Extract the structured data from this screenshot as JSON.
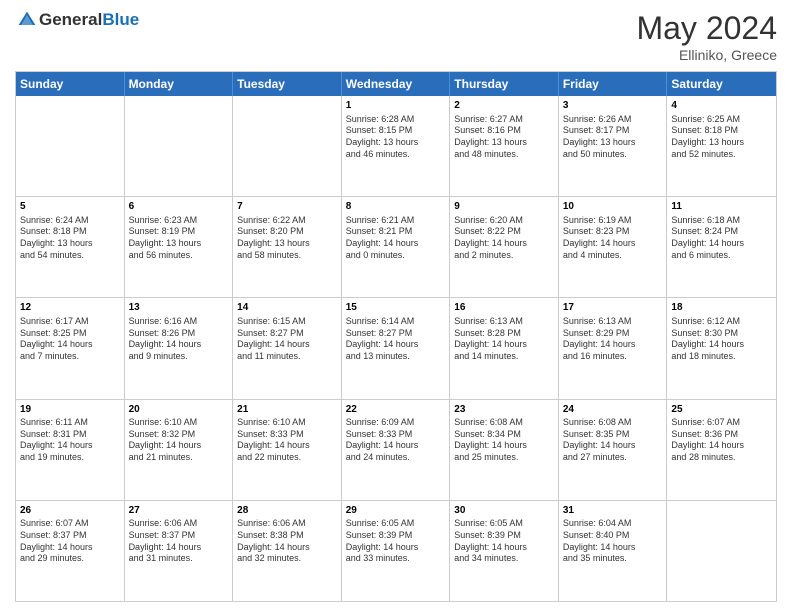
{
  "header": {
    "logo": {
      "general": "General",
      "blue": "Blue"
    },
    "title": "May 2024",
    "location": "Elliniko, Greece"
  },
  "weekdays": [
    "Sunday",
    "Monday",
    "Tuesday",
    "Wednesday",
    "Thursday",
    "Friday",
    "Saturday"
  ],
  "rows": [
    [
      {
        "date": "",
        "info": ""
      },
      {
        "date": "",
        "info": ""
      },
      {
        "date": "",
        "info": ""
      },
      {
        "date": "1",
        "info": "Sunrise: 6:28 AM\nSunset: 8:15 PM\nDaylight: 13 hours\nand 46 minutes."
      },
      {
        "date": "2",
        "info": "Sunrise: 6:27 AM\nSunset: 8:16 PM\nDaylight: 13 hours\nand 48 minutes."
      },
      {
        "date": "3",
        "info": "Sunrise: 6:26 AM\nSunset: 8:17 PM\nDaylight: 13 hours\nand 50 minutes."
      },
      {
        "date": "4",
        "info": "Sunrise: 6:25 AM\nSunset: 8:18 PM\nDaylight: 13 hours\nand 52 minutes."
      }
    ],
    [
      {
        "date": "5",
        "info": "Sunrise: 6:24 AM\nSunset: 8:18 PM\nDaylight: 13 hours\nand 54 minutes."
      },
      {
        "date": "6",
        "info": "Sunrise: 6:23 AM\nSunset: 8:19 PM\nDaylight: 13 hours\nand 56 minutes."
      },
      {
        "date": "7",
        "info": "Sunrise: 6:22 AM\nSunset: 8:20 PM\nDaylight: 13 hours\nand 58 minutes."
      },
      {
        "date": "8",
        "info": "Sunrise: 6:21 AM\nSunset: 8:21 PM\nDaylight: 14 hours\nand 0 minutes."
      },
      {
        "date": "9",
        "info": "Sunrise: 6:20 AM\nSunset: 8:22 PM\nDaylight: 14 hours\nand 2 minutes."
      },
      {
        "date": "10",
        "info": "Sunrise: 6:19 AM\nSunset: 8:23 PM\nDaylight: 14 hours\nand 4 minutes."
      },
      {
        "date": "11",
        "info": "Sunrise: 6:18 AM\nSunset: 8:24 PM\nDaylight: 14 hours\nand 6 minutes."
      }
    ],
    [
      {
        "date": "12",
        "info": "Sunrise: 6:17 AM\nSunset: 8:25 PM\nDaylight: 14 hours\nand 7 minutes."
      },
      {
        "date": "13",
        "info": "Sunrise: 6:16 AM\nSunset: 8:26 PM\nDaylight: 14 hours\nand 9 minutes."
      },
      {
        "date": "14",
        "info": "Sunrise: 6:15 AM\nSunset: 8:27 PM\nDaylight: 14 hours\nand 11 minutes."
      },
      {
        "date": "15",
        "info": "Sunrise: 6:14 AM\nSunset: 8:27 PM\nDaylight: 14 hours\nand 13 minutes."
      },
      {
        "date": "16",
        "info": "Sunrise: 6:13 AM\nSunset: 8:28 PM\nDaylight: 14 hours\nand 14 minutes."
      },
      {
        "date": "17",
        "info": "Sunrise: 6:13 AM\nSunset: 8:29 PM\nDaylight: 14 hours\nand 16 minutes."
      },
      {
        "date": "18",
        "info": "Sunrise: 6:12 AM\nSunset: 8:30 PM\nDaylight: 14 hours\nand 18 minutes."
      }
    ],
    [
      {
        "date": "19",
        "info": "Sunrise: 6:11 AM\nSunset: 8:31 PM\nDaylight: 14 hours\nand 19 minutes."
      },
      {
        "date": "20",
        "info": "Sunrise: 6:10 AM\nSunset: 8:32 PM\nDaylight: 14 hours\nand 21 minutes."
      },
      {
        "date": "21",
        "info": "Sunrise: 6:10 AM\nSunset: 8:33 PM\nDaylight: 14 hours\nand 22 minutes."
      },
      {
        "date": "22",
        "info": "Sunrise: 6:09 AM\nSunset: 8:33 PM\nDaylight: 14 hours\nand 24 minutes."
      },
      {
        "date": "23",
        "info": "Sunrise: 6:08 AM\nSunset: 8:34 PM\nDaylight: 14 hours\nand 25 minutes."
      },
      {
        "date": "24",
        "info": "Sunrise: 6:08 AM\nSunset: 8:35 PM\nDaylight: 14 hours\nand 27 minutes."
      },
      {
        "date": "25",
        "info": "Sunrise: 6:07 AM\nSunset: 8:36 PM\nDaylight: 14 hours\nand 28 minutes."
      }
    ],
    [
      {
        "date": "26",
        "info": "Sunrise: 6:07 AM\nSunset: 8:37 PM\nDaylight: 14 hours\nand 29 minutes."
      },
      {
        "date": "27",
        "info": "Sunrise: 6:06 AM\nSunset: 8:37 PM\nDaylight: 14 hours\nand 31 minutes."
      },
      {
        "date": "28",
        "info": "Sunrise: 6:06 AM\nSunset: 8:38 PM\nDaylight: 14 hours\nand 32 minutes."
      },
      {
        "date": "29",
        "info": "Sunrise: 6:05 AM\nSunset: 8:39 PM\nDaylight: 14 hours\nand 33 minutes."
      },
      {
        "date": "30",
        "info": "Sunrise: 6:05 AM\nSunset: 8:39 PM\nDaylight: 14 hours\nand 34 minutes."
      },
      {
        "date": "31",
        "info": "Sunrise: 6:04 AM\nSunset: 8:40 PM\nDaylight: 14 hours\nand 35 minutes."
      },
      {
        "date": "",
        "info": ""
      }
    ]
  ]
}
